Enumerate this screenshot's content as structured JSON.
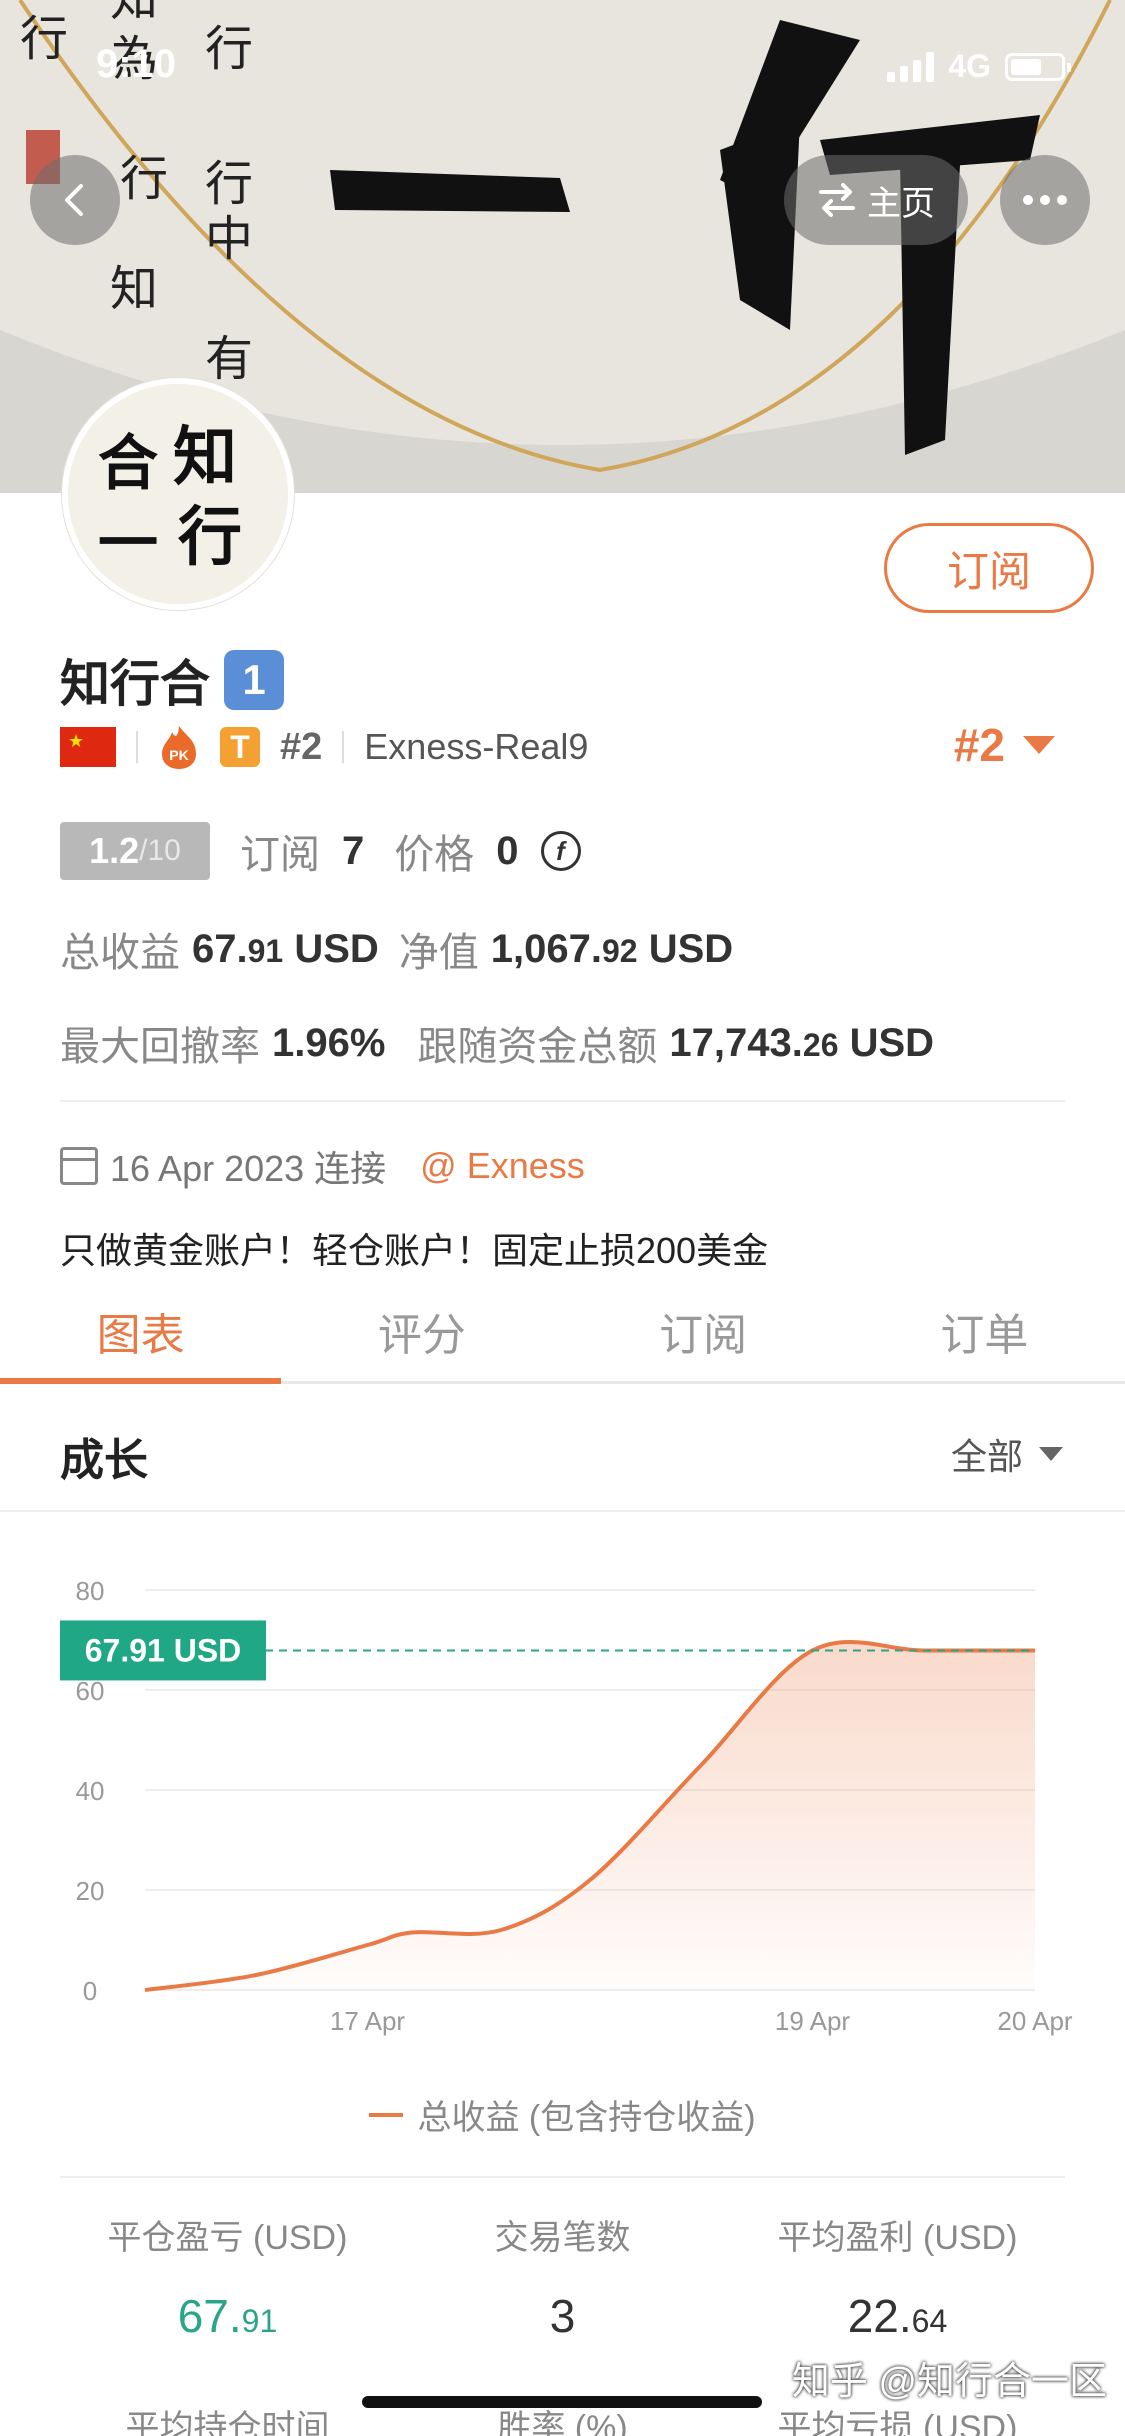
{
  "status_bar": {
    "time": "9:10",
    "network": "4G"
  },
  "header": {
    "home_label": "主页"
  },
  "profile": {
    "name": "知行合",
    "rank_badge": "1",
    "level_badge": "T",
    "rank": "#2",
    "account": "Exness-Real9",
    "subscribe_label": "订阅",
    "score": "1.2",
    "score_max": "/10",
    "subscribers_label": "订阅",
    "subscribers": "7",
    "price_label": "价格",
    "price": "0",
    "total_profit_label": "总收益",
    "total_profit_main": "67.",
    "total_profit_dec": "91",
    "total_profit_unit": "USD",
    "equity_label": "净值",
    "equity_main": "1,067.",
    "equity_dec": "92",
    "equity_unit": "USD",
    "drawdown_label": "最大回撤率",
    "drawdown": "1.96%",
    "following_label": "跟随资金总额",
    "following_main": "17,743.",
    "following_dec": "26",
    "following_unit": "USD",
    "connect_date": "16 Apr 2023 连接",
    "broker": "@ Exness",
    "description": "只做黄金账户！轻仓账户！固定止损200美金"
  },
  "tabs": [
    "图表",
    "评分",
    "订阅",
    "订单"
  ],
  "section": {
    "title": "成长",
    "filter": "全部"
  },
  "chart_data": {
    "type": "area",
    "x": [
      "16 Apr",
      "16.5 Apr",
      "17 Apr",
      "17.2 Apr",
      "17.6 Apr",
      "18 Apr",
      "18.5 Apr",
      "19 Apr",
      "19.5 Apr",
      "20 Apr"
    ],
    "x_ticks": [
      "17 Apr",
      "19 Apr",
      "20 Apr"
    ],
    "y_ticks": [
      "0",
      "20",
      "40",
      "60",
      "80"
    ],
    "ylim": [
      0,
      80
    ],
    "series": [
      {
        "name": "总收益 (包含持仓收益)",
        "values": [
          0,
          3,
          9,
          11.5,
          12,
          22,
          45,
          67.91,
          67.91,
          67.91
        ],
        "color": "#ea7a45"
      }
    ],
    "marker_label": "67.91 USD",
    "marker_value": 67.91,
    "legend": "总收益 (包含持仓收益)"
  },
  "stats": [
    {
      "label": "平仓盈亏 (USD)",
      "main": "67.",
      "dec": "91",
      "color": "#2aa58a"
    },
    {
      "label": "交易笔数",
      "main": "3",
      "dec": ""
    },
    {
      "label": "平均盈利 (USD)",
      "main": "22.",
      "dec": "64"
    }
  ],
  "stats_row2": [
    {
      "label": "平均持仓时间"
    },
    {
      "label": "胜率 (%)"
    },
    {
      "label": "平均亏损 (USD)"
    }
  ],
  "watermark": "知乎 @知行合一区"
}
